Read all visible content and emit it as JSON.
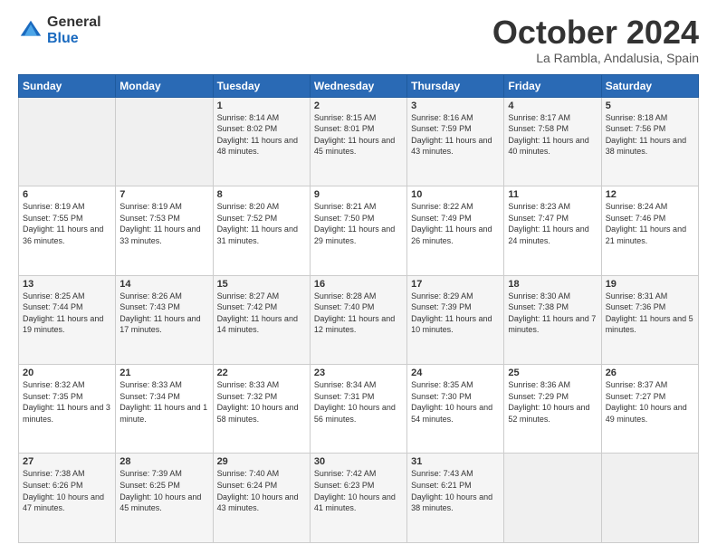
{
  "logo": {
    "general": "General",
    "blue": "Blue"
  },
  "title": {
    "month": "October 2024",
    "location": "La Rambla, Andalusia, Spain"
  },
  "headers": [
    "Sunday",
    "Monday",
    "Tuesday",
    "Wednesday",
    "Thursday",
    "Friday",
    "Saturday"
  ],
  "weeks": [
    [
      {
        "day": "",
        "info": ""
      },
      {
        "day": "",
        "info": ""
      },
      {
        "day": "1",
        "info": "Sunrise: 8:14 AM\nSunset: 8:02 PM\nDaylight: 11 hours and 48 minutes."
      },
      {
        "day": "2",
        "info": "Sunrise: 8:15 AM\nSunset: 8:01 PM\nDaylight: 11 hours and 45 minutes."
      },
      {
        "day": "3",
        "info": "Sunrise: 8:16 AM\nSunset: 7:59 PM\nDaylight: 11 hours and 43 minutes."
      },
      {
        "day": "4",
        "info": "Sunrise: 8:17 AM\nSunset: 7:58 PM\nDaylight: 11 hours and 40 minutes."
      },
      {
        "day": "5",
        "info": "Sunrise: 8:18 AM\nSunset: 7:56 PM\nDaylight: 11 hours and 38 minutes."
      }
    ],
    [
      {
        "day": "6",
        "info": "Sunrise: 8:19 AM\nSunset: 7:55 PM\nDaylight: 11 hours and 36 minutes."
      },
      {
        "day": "7",
        "info": "Sunrise: 8:19 AM\nSunset: 7:53 PM\nDaylight: 11 hours and 33 minutes."
      },
      {
        "day": "8",
        "info": "Sunrise: 8:20 AM\nSunset: 7:52 PM\nDaylight: 11 hours and 31 minutes."
      },
      {
        "day": "9",
        "info": "Sunrise: 8:21 AM\nSunset: 7:50 PM\nDaylight: 11 hours and 29 minutes."
      },
      {
        "day": "10",
        "info": "Sunrise: 8:22 AM\nSunset: 7:49 PM\nDaylight: 11 hours and 26 minutes."
      },
      {
        "day": "11",
        "info": "Sunrise: 8:23 AM\nSunset: 7:47 PM\nDaylight: 11 hours and 24 minutes."
      },
      {
        "day": "12",
        "info": "Sunrise: 8:24 AM\nSunset: 7:46 PM\nDaylight: 11 hours and 21 minutes."
      }
    ],
    [
      {
        "day": "13",
        "info": "Sunrise: 8:25 AM\nSunset: 7:44 PM\nDaylight: 11 hours and 19 minutes."
      },
      {
        "day": "14",
        "info": "Sunrise: 8:26 AM\nSunset: 7:43 PM\nDaylight: 11 hours and 17 minutes."
      },
      {
        "day": "15",
        "info": "Sunrise: 8:27 AM\nSunset: 7:42 PM\nDaylight: 11 hours and 14 minutes."
      },
      {
        "day": "16",
        "info": "Sunrise: 8:28 AM\nSunset: 7:40 PM\nDaylight: 11 hours and 12 minutes."
      },
      {
        "day": "17",
        "info": "Sunrise: 8:29 AM\nSunset: 7:39 PM\nDaylight: 11 hours and 10 minutes."
      },
      {
        "day": "18",
        "info": "Sunrise: 8:30 AM\nSunset: 7:38 PM\nDaylight: 11 hours and 7 minutes."
      },
      {
        "day": "19",
        "info": "Sunrise: 8:31 AM\nSunset: 7:36 PM\nDaylight: 11 hours and 5 minutes."
      }
    ],
    [
      {
        "day": "20",
        "info": "Sunrise: 8:32 AM\nSunset: 7:35 PM\nDaylight: 11 hours and 3 minutes."
      },
      {
        "day": "21",
        "info": "Sunrise: 8:33 AM\nSunset: 7:34 PM\nDaylight: 11 hours and 1 minute."
      },
      {
        "day": "22",
        "info": "Sunrise: 8:33 AM\nSunset: 7:32 PM\nDaylight: 10 hours and 58 minutes."
      },
      {
        "day": "23",
        "info": "Sunrise: 8:34 AM\nSunset: 7:31 PM\nDaylight: 10 hours and 56 minutes."
      },
      {
        "day": "24",
        "info": "Sunrise: 8:35 AM\nSunset: 7:30 PM\nDaylight: 10 hours and 54 minutes."
      },
      {
        "day": "25",
        "info": "Sunrise: 8:36 AM\nSunset: 7:29 PM\nDaylight: 10 hours and 52 minutes."
      },
      {
        "day": "26",
        "info": "Sunrise: 8:37 AM\nSunset: 7:27 PM\nDaylight: 10 hours and 49 minutes."
      }
    ],
    [
      {
        "day": "27",
        "info": "Sunrise: 7:38 AM\nSunset: 6:26 PM\nDaylight: 10 hours and 47 minutes."
      },
      {
        "day": "28",
        "info": "Sunrise: 7:39 AM\nSunset: 6:25 PM\nDaylight: 10 hours and 45 minutes."
      },
      {
        "day": "29",
        "info": "Sunrise: 7:40 AM\nSunset: 6:24 PM\nDaylight: 10 hours and 43 minutes."
      },
      {
        "day": "30",
        "info": "Sunrise: 7:42 AM\nSunset: 6:23 PM\nDaylight: 10 hours and 41 minutes."
      },
      {
        "day": "31",
        "info": "Sunrise: 7:43 AM\nSunset: 6:21 PM\nDaylight: 10 hours and 38 minutes."
      },
      {
        "day": "",
        "info": ""
      },
      {
        "day": "",
        "info": ""
      }
    ]
  ]
}
